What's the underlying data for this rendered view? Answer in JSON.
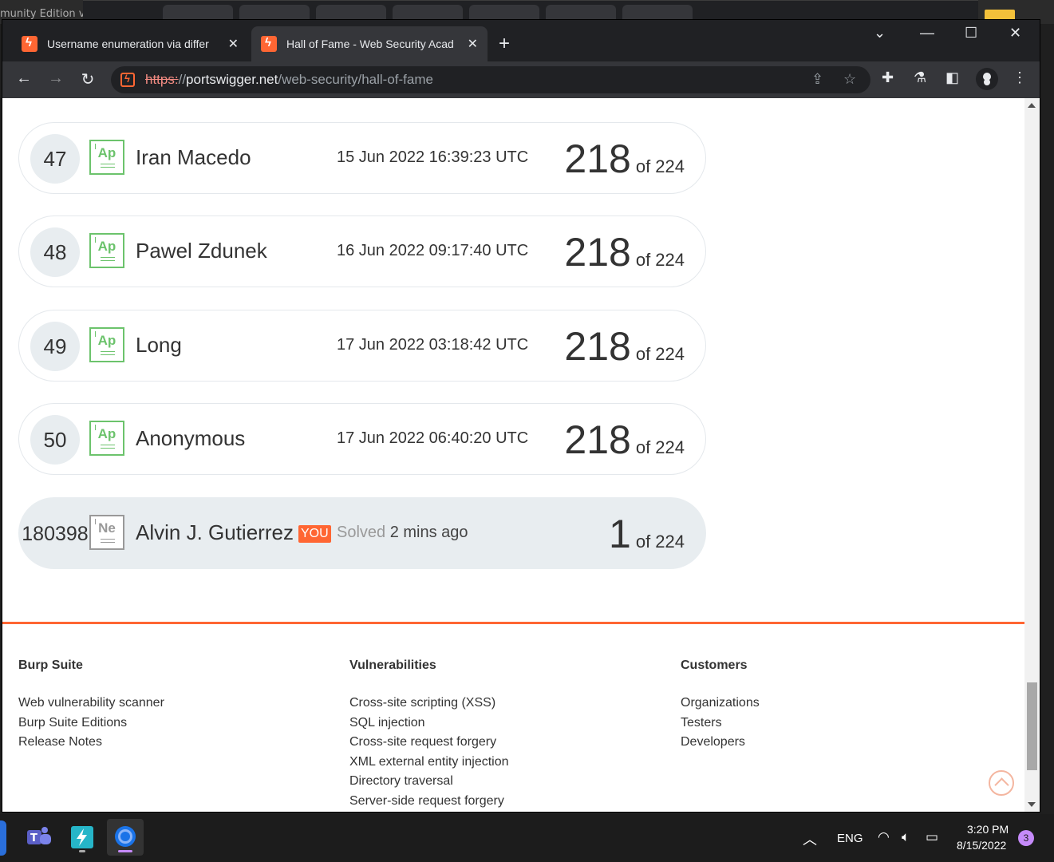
{
  "background": {
    "window_text": "munity Edition v"
  },
  "tabs": [
    {
      "title": "Username enumeration via differ",
      "active": false
    },
    {
      "title": "Hall of Fame - Web Security Acad",
      "active": true
    }
  ],
  "address_bar": {
    "scheme": "https:",
    "separator": "//",
    "host": "portswigger.net",
    "path": "/web-security/hall-of-fame"
  },
  "leaderboard": [
    {
      "rank": "47",
      "badge": "Ap",
      "name": "Iran Macedo",
      "date": "15 Jun 2022 16:39:23 UTC",
      "solved": "218",
      "of": "of 224"
    },
    {
      "rank": "48",
      "badge": "Ap",
      "name": "Pawel Zdunek",
      "date": "16 Jun 2022 09:17:40 UTC",
      "solved": "218",
      "of": "of 224"
    },
    {
      "rank": "49",
      "badge": "Ap",
      "name": "Long",
      "date": "17 Jun 2022 03:18:42 UTC",
      "solved": "218",
      "of": "of 224"
    },
    {
      "rank": "50",
      "badge": "Ap",
      "name": "Anonymous",
      "date": "17 Jun 2022 06:40:20 UTC",
      "solved": "218",
      "of": "of 224"
    }
  ],
  "current_user": {
    "rank": "180398",
    "badge": "Ne",
    "name": "Alvin J. Gutierrez",
    "you_tag": "YOU",
    "solved_label": "Solved",
    "solved_ago": "2 mins ago",
    "solved": "1",
    "of": "of 224"
  },
  "footer": {
    "columns": [
      {
        "heading": "Burp Suite",
        "links": [
          "Web vulnerability scanner",
          "Burp Suite Editions",
          "Release Notes"
        ]
      },
      {
        "heading": "Vulnerabilities",
        "links": [
          "Cross-site scripting (XSS)",
          "SQL injection",
          "Cross-site request forgery",
          "XML external entity injection",
          "Directory traversal",
          "Server-side request forgery"
        ]
      },
      {
        "heading": "Customers",
        "links": [
          "Organizations",
          "Testers",
          "Developers"
        ]
      }
    ]
  },
  "taskbar": {
    "language": "ENG",
    "time": "3:20 PM",
    "date": "8/15/2022",
    "notifications": "3"
  },
  "colors": {
    "brand_orange": "#ff6633",
    "badge_green": "#6cc36c",
    "badge_grey": "#999999",
    "row_highlight": "#e8edf0"
  }
}
